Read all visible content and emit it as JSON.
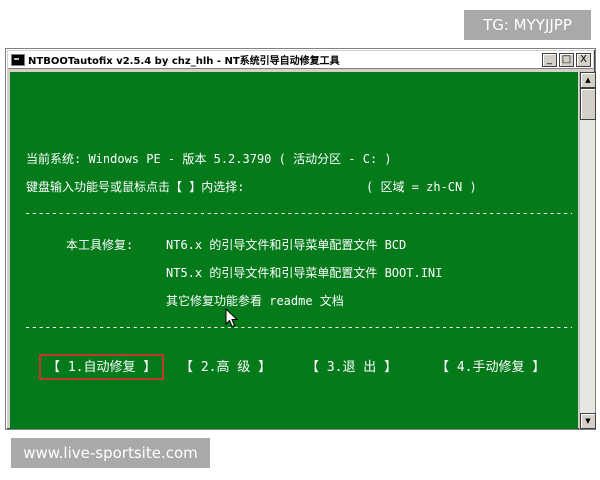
{
  "watermarks": {
    "top": "TG: MYYJJPP",
    "bottom": "www.live-sportsite.com"
  },
  "window": {
    "title": "NTBOOTautofix v2.5.4 by chz_hlh - NT系统引导自动修复工具",
    "buttons": {
      "minimize": "_",
      "maximize": "□",
      "close": "X"
    }
  },
  "console": {
    "system_line": "当前系统: Windows PE - 版本 5.2.3790  ( 活动分区 - C: )",
    "input_prompt": "键盘输入功能号或鼠标点击【 】内选择:",
    "region": "( 区域 = zh-CN )",
    "divider": "-----------------------------------------------------------------------------------------------------",
    "repair_label": "本工具修复:",
    "repair_items": [
      "NT6.x 的引导文件和引导菜单配置文件 BCD",
      "NT5.x 的引导文件和引导菜单配置文件 BOOT.INI",
      "其它修复功能参看 readme 文档"
    ],
    "menu": [
      {
        "label": "【 1.自动修复 】",
        "selected": true
      },
      {
        "label": "【  2.高  级  】",
        "selected": false
      },
      {
        "label": "【  3.退  出  】",
        "selected": false
      },
      {
        "label": "【 4.手动修复 】",
        "selected": false
      }
    ]
  },
  "colors": {
    "console_bg": "#047a1b",
    "console_text": "#ffffff",
    "selection_border": "#c0392b"
  },
  "icons": [
    "app-icon",
    "minimize-icon",
    "maximize-icon",
    "close-icon",
    "scroll-up-icon",
    "scroll-down-icon",
    "mouse-cursor-icon"
  ]
}
